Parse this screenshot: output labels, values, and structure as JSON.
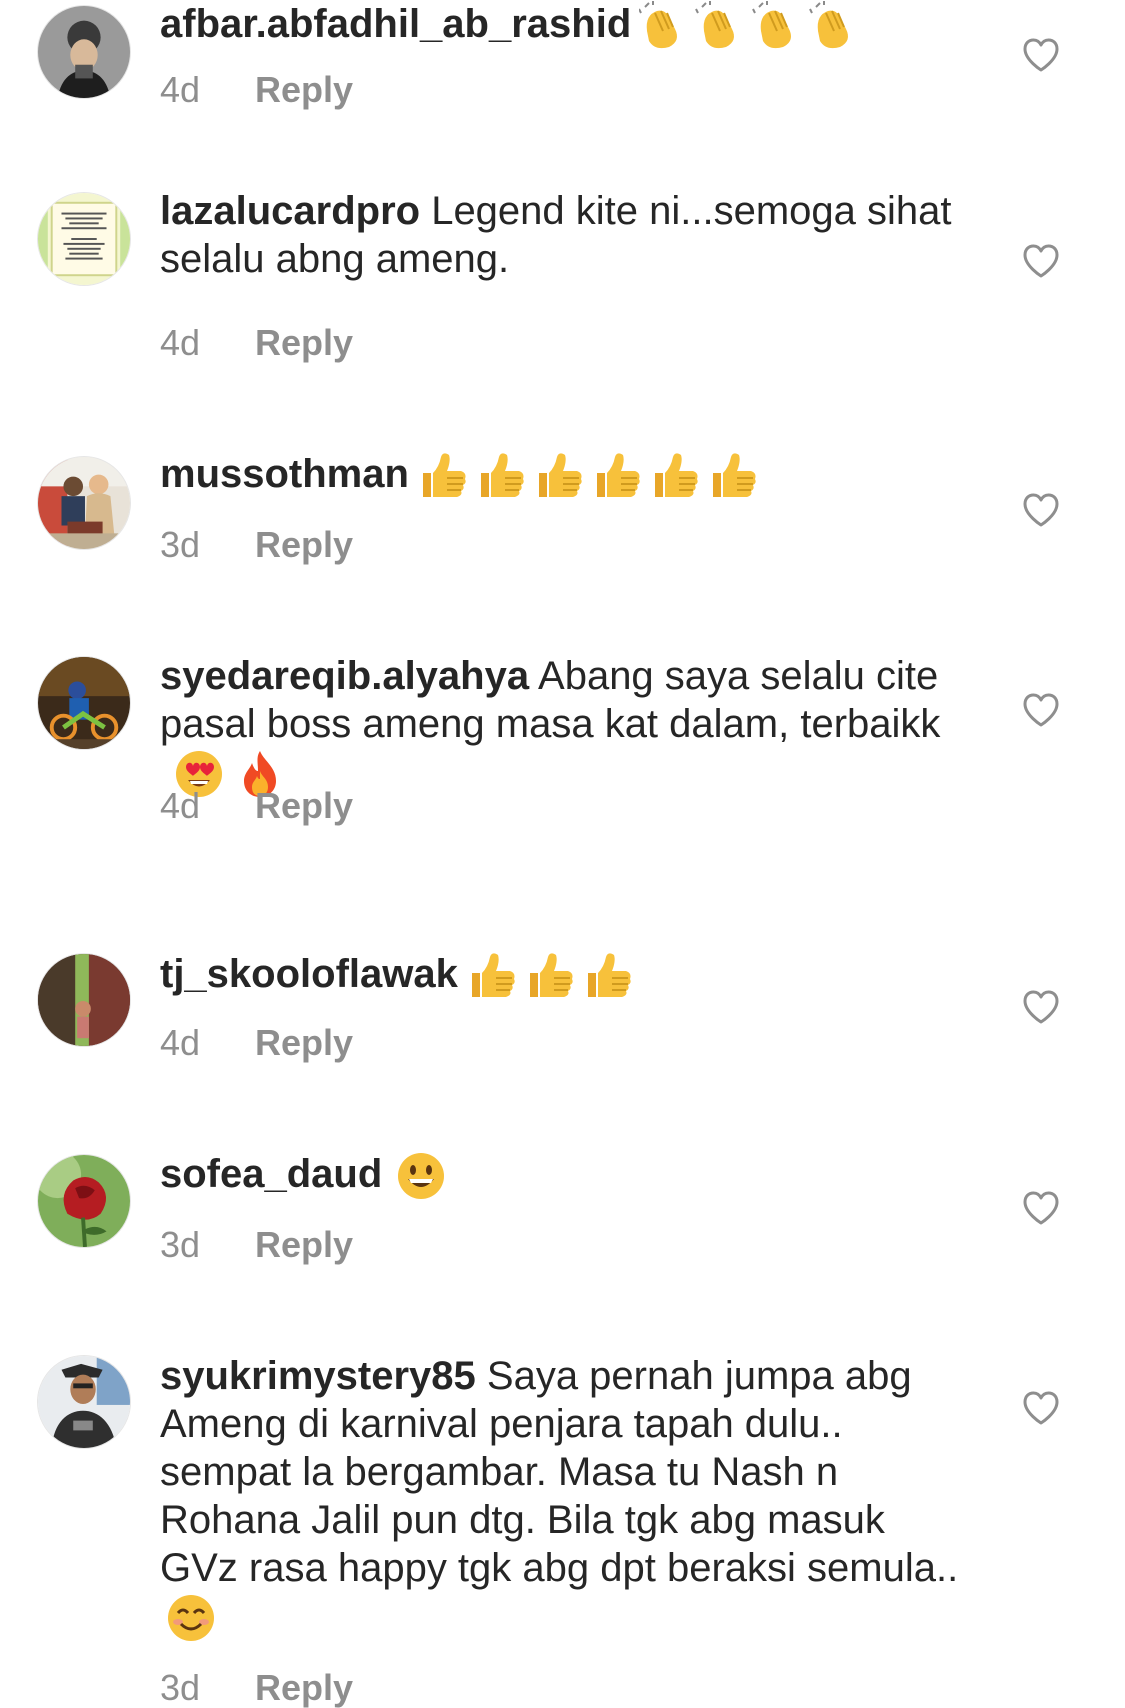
{
  "comments": [
    {
      "username": "afbar.abfadhil_ab_rashid",
      "text": "",
      "emoji": [
        "clap",
        "clap",
        "clap",
        "clap"
      ],
      "time": "4d",
      "reply_label": "Reply"
    },
    {
      "username": "lazalucardpro",
      "text": " Legend kite ni...semoga sihat selalu abng ameng.",
      "emoji": [],
      "time": "4d",
      "reply_label": "Reply",
      "avatar_text": "\"NERAKA tidak pernah memanggil kita, tapi kita sendiri yang MENDEKATINYA\". Namun \"SYURGA sentiasa menunggu kita, tapi kita yang MENJAUHI darinya\""
    },
    {
      "username": "mussothman",
      "text": "",
      "emoji": [
        "thumbs-up",
        "thumbs-up",
        "thumbs-up",
        "thumbs-up",
        "thumbs-up",
        "thumbs-up"
      ],
      "time": "3d",
      "reply_label": "Reply"
    },
    {
      "username": "syedareqib.alyahya",
      "text": " Abang saya selalu cite pasal boss ameng masa kat dalam, terbaikk",
      "emoji": [
        "heart-eyes",
        "fire"
      ],
      "time": "4d",
      "reply_label": "Reply"
    },
    {
      "username": "tj_skooloflawak",
      "text": "",
      "emoji": [
        "thumbs-up",
        "thumbs-up",
        "thumbs-up"
      ],
      "time": "4d",
      "reply_label": "Reply"
    },
    {
      "username": "sofea_daud",
      "text": "",
      "emoji": [
        "grinning"
      ],
      "time": "3d",
      "reply_label": "Reply"
    },
    {
      "username": "syukrimystery85",
      "text": " Saya pernah jumpa abg Ameng di karnival penjara tapah dulu.. sempat la bergambar. Masa tu Nash n Rohana Jalil pun dtg. Bila tgk abg masuk GVz rasa happy tgk abg dpt beraksi semula..",
      "emoji": [
        "smiling"
      ],
      "time": "3d",
      "reply_label": "Reply"
    }
  ],
  "icons": {
    "like": "heart-outline-icon"
  },
  "colors": {
    "text": "#262626",
    "secondary": "#8e8e8e",
    "background": "#ffffff"
  }
}
